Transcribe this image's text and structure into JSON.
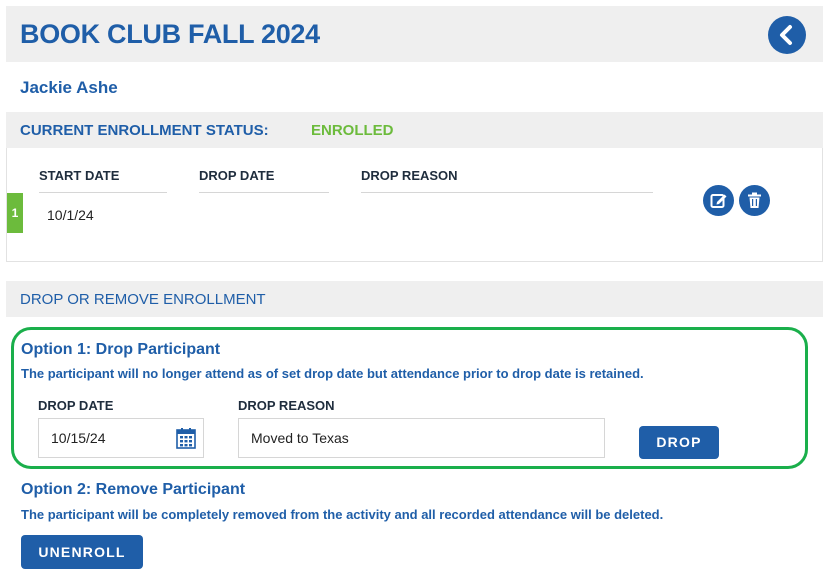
{
  "header": {
    "title": "BOOK CLUB FALL 2024"
  },
  "participant": {
    "name": "Jackie Ashe"
  },
  "enrollment": {
    "status_label": "CURRENT ENROLLMENT STATUS:",
    "status_value": "ENROLLED",
    "columns": [
      "START DATE",
      "DROP DATE",
      "DROP REASON"
    ],
    "rows": [
      {
        "num": "1",
        "start_date": "10/1/24",
        "drop_date": "",
        "drop_reason": ""
      }
    ]
  },
  "drop_section": {
    "title": "DROP OR REMOVE ENROLLMENT",
    "option1": {
      "title": "Option 1: Drop Participant",
      "description": "The participant will no longer attend as of set drop date but attendance prior to drop date is retained.",
      "drop_date_label": "DROP DATE",
      "drop_date_value": "10/15/24",
      "drop_reason_label": "DROP REASON",
      "drop_reason_value": "Moved to Texas",
      "button_label": "DROP"
    },
    "option2": {
      "title": "Option 2: Remove Participant",
      "description": "The participant will be completely removed from the activity and all recorded attendance will be deleted.",
      "button_label": "UNENROLL"
    }
  },
  "icons": {
    "back": "chevron-left-icon",
    "edit": "edit-icon",
    "delete": "trash-icon",
    "calendar": "calendar-icon"
  },
  "colors": {
    "primary": "#1f5ea8",
    "enrolled": "#6cbb3c",
    "option_highlight": "#1aaf4b",
    "section_bg": "#efefef"
  }
}
